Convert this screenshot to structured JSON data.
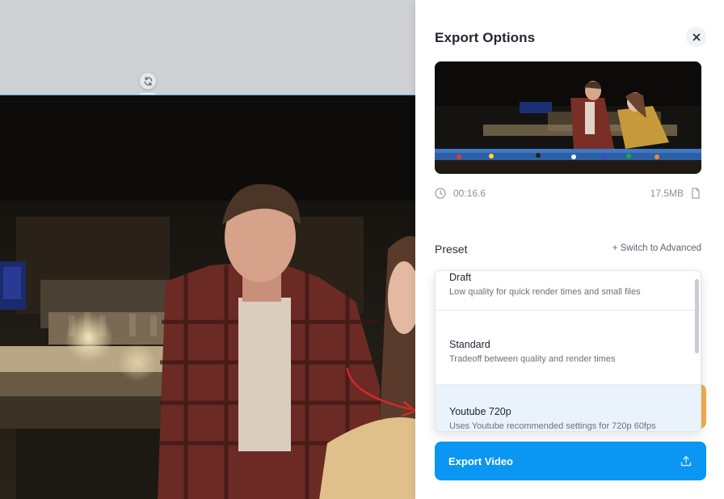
{
  "panel": {
    "title": "Export Options",
    "close_icon": "close-icon",
    "duration": "00:16.6",
    "file_size": "17.5MB",
    "preset_label": "Preset",
    "switch_link": "+ Switch to Advanced",
    "export_button": "Export Video",
    "export_icon": "upload-icon"
  },
  "presets": [
    {
      "name": "Draft",
      "description": "Low quality for quick render times and small files"
    },
    {
      "name": "Standard",
      "description": "Tradeoff between quality and render times"
    },
    {
      "name": "Youtube 720p",
      "description": "Uses Youtube recommended settings for 720p 60fps"
    }
  ],
  "selected_preset": "Youtube 720p",
  "colors": {
    "accent": "#0a96f2",
    "annotation_arrow": "#d32a2a",
    "selection_line": "#3aa6d6"
  }
}
